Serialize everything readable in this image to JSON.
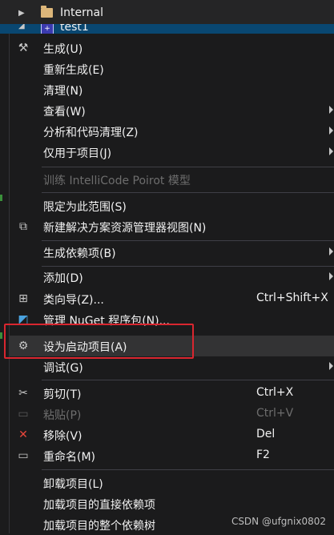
{
  "tree": {
    "rows": [
      {
        "label": "Internal"
      },
      {
        "label": "test1"
      }
    ]
  },
  "menu": {
    "items": [
      {
        "label": "生成(U)",
        "icon": "build-icon"
      },
      {
        "label": "重新生成(E)"
      },
      {
        "label": "清理(N)"
      },
      {
        "label": "查看(W)",
        "submenu": true
      },
      {
        "label": "分析和代码清理(Z)",
        "submenu": true
      },
      {
        "label": "仅用于项目(J)",
        "submenu": true
      },
      {
        "label": "训练 IntelliCode Poirot 模型",
        "disabled": true
      },
      {
        "label": "限定为此范围(S)"
      },
      {
        "label": "新建解决方案资源管理器视图(N)",
        "icon": "new-view-icon"
      },
      {
        "label": "生成依赖项(B)",
        "submenu": true
      },
      {
        "label": "添加(D)",
        "submenu": true
      },
      {
        "label": "类向导(Z)...",
        "shortcut": "Ctrl+Shift+X",
        "icon": "class-wizard-icon"
      },
      {
        "label": "管理 NuGet 程序包(N)...",
        "icon": "nuget-icon"
      },
      {
        "label": "设为启动项目(A)",
        "icon": "gear-icon"
      },
      {
        "label": "调试(G)",
        "submenu": true
      },
      {
        "label": "剪切(T)",
        "shortcut": "Ctrl+X",
        "icon": "scissors-icon"
      },
      {
        "label": "粘贴(P)",
        "shortcut": "Ctrl+V",
        "disabled": true,
        "icon": "paste-icon"
      },
      {
        "label": "移除(V)",
        "shortcut": "Del",
        "icon": "close-icon"
      },
      {
        "label": "重命名(M)",
        "shortcut": "F2",
        "icon": "rename-icon"
      },
      {
        "label": "卸载项目(L)"
      },
      {
        "label": "加载项目的直接依赖项"
      },
      {
        "label": "加载项目的整个依赖树"
      }
    ]
  },
  "watermark": "CSDN @ufgnix0802",
  "colors": {
    "highlight_box": "#d9262f",
    "selected_row": "#094771"
  }
}
